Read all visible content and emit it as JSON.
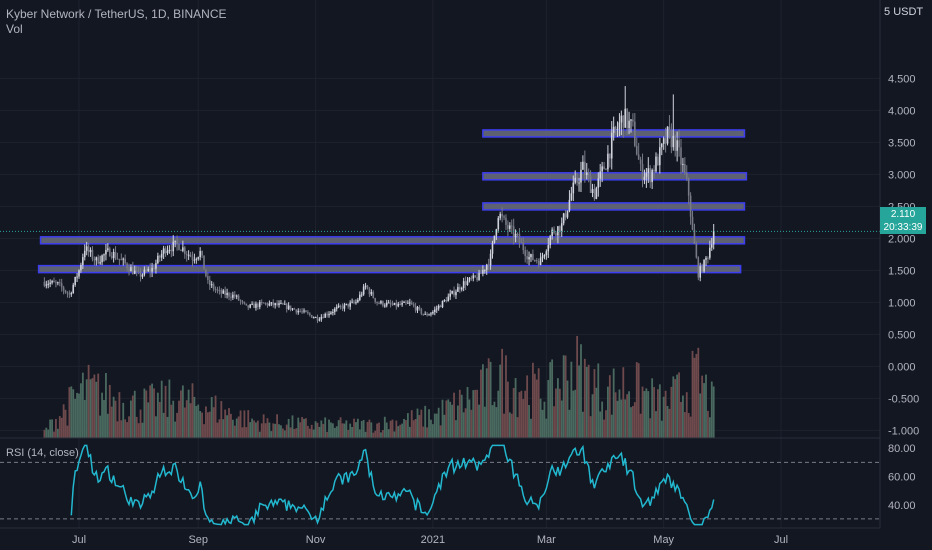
{
  "header": {
    "title": "Kyber Network / TetherUS, 1D, BINANCE",
    "volume_label": "Vol",
    "currency": "USDT"
  },
  "price_badge": {
    "price": "2.110",
    "countdown": "20:33:39",
    "color": "#26a69a"
  },
  "rsi": {
    "label": "RSI (14, close)",
    "ticks": [
      "80.00",
      "60.00",
      "40.00"
    ],
    "bands": [
      70,
      30
    ],
    "ylim": [
      25,
      83
    ],
    "color": "#22b8cf"
  },
  "colors": {
    "background": "#131722",
    "up": "#d1d4dc",
    "down": "#787b86",
    "zone_fill": "#6b6f80",
    "zone_border": "#3d3ef0",
    "grid": "#1e222d"
  },
  "chart_data": {
    "type": "candlestick",
    "title": "Kyber Network / TetherUS, 1D, BINANCE",
    "y_axis_ticks": [
      "4.500",
      "4.000",
      "3.500",
      "3.000",
      "2.500",
      "2.000",
      "1.500",
      "1.000",
      "0.500",
      "0.000",
      "-0.500",
      "-1.000"
    ],
    "ylim": [
      -1.15,
      5.1
    ],
    "x_axis_ticks": [
      "Jul",
      "Sep",
      "Nov",
      "2021",
      "Mar",
      "May",
      "Jul"
    ],
    "x_tick_dates": [
      "2020-07-01",
      "2020-09-01",
      "2020-11-01",
      "2021-01-01",
      "2021-03-01",
      "2021-05-01",
      "2021-07-01"
    ],
    "date_range": [
      "2020-06-13",
      "2021-05-22"
    ],
    "last_price": 2.11,
    "horizontal_zones": [
      {
        "price": 1.52,
        "start": "2020-06-10",
        "end": "2021-06-10"
      },
      {
        "price": 1.97,
        "start": "2020-06-11",
        "end": "2021-06-12"
      },
      {
        "price": 2.5,
        "start": "2021-01-27",
        "end": "2021-06-12"
      },
      {
        "price": 2.97,
        "start": "2021-01-27",
        "end": "2021-06-13"
      },
      {
        "price": 3.64,
        "start": "2021-01-27",
        "end": "2021-06-12"
      }
    ],
    "price_path": [
      [
        "2020-06-13",
        1.32
      ],
      [
        "2020-06-20",
        1.28
      ],
      [
        "2020-06-26",
        1.12
      ],
      [
        "2020-07-01",
        1.5
      ],
      [
        "2020-07-04",
        1.85
      ],
      [
        "2020-07-10",
        1.65
      ],
      [
        "2020-07-17",
        1.8
      ],
      [
        "2020-07-25",
        1.6
      ],
      [
        "2020-08-01",
        1.42
      ],
      [
        "2020-08-08",
        1.52
      ],
      [
        "2020-08-15",
        1.85
      ],
      [
        "2020-08-22",
        1.9
      ],
      [
        "2020-08-29",
        1.7
      ],
      [
        "2020-09-02",
        1.78
      ],
      [
        "2020-09-06",
        1.3
      ],
      [
        "2020-09-12",
        1.15
      ],
      [
        "2020-09-20",
        1.1
      ],
      [
        "2020-09-26",
        0.92
      ],
      [
        "2020-10-05",
        0.98
      ],
      [
        "2020-10-15",
        0.95
      ],
      [
        "2020-10-25",
        0.85
      ],
      [
        "2020-11-02",
        0.75
      ],
      [
        "2020-11-12",
        0.9
      ],
      [
        "2020-11-22",
        1.0
      ],
      [
        "2020-11-27",
        1.25
      ],
      [
        "2020-12-03",
        1.0
      ],
      [
        "2020-12-12",
        0.95
      ],
      [
        "2020-12-20",
        0.98
      ],
      [
        "2020-12-28",
        0.8
      ],
      [
        "2021-01-01",
        0.85
      ],
      [
        "2021-01-08",
        1.05
      ],
      [
        "2021-01-17",
        1.3
      ],
      [
        "2021-01-25",
        1.4
      ],
      [
        "2021-01-31",
        1.7
      ],
      [
        "2021-02-04",
        2.4
      ],
      [
        "2021-02-08",
        2.2
      ],
      [
        "2021-02-14",
        2.0
      ],
      [
        "2021-02-20",
        1.7
      ],
      [
        "2021-02-26",
        1.65
      ],
      [
        "2021-03-04",
        2.1
      ],
      [
        "2021-03-09",
        2.2
      ],
      [
        "2021-03-14",
        2.7
      ],
      [
        "2021-03-20",
        3.1
      ],
      [
        "2021-03-26",
        2.7
      ],
      [
        "2021-04-01",
        3.2
      ],
      [
        "2021-04-05",
        3.6
      ],
      [
        "2021-04-10",
        3.9
      ],
      [
        "2021-04-15",
        3.7
      ],
      [
        "2021-04-19",
        3.05
      ],
      [
        "2021-04-24",
        3.0
      ],
      [
        "2021-04-29",
        3.3
      ],
      [
        "2021-05-03",
        3.6
      ],
      [
        "2021-05-07",
        3.5
      ],
      [
        "2021-05-11",
        3.1
      ],
      [
        "2021-05-14",
        2.7
      ],
      [
        "2021-05-16",
        2.1
      ],
      [
        "2021-05-19",
        1.45
      ],
      [
        "2021-05-22",
        1.6
      ],
      [
        "2021-05-24",
        1.75
      ],
      [
        "2021-05-27",
        2.11
      ]
    ],
    "volume_profile": [
      [
        "2020-06-13",
        0.06
      ],
      [
        "2020-07-04",
        0.45
      ],
      [
        "2020-08-01",
        0.3
      ],
      [
        "2020-08-20",
        0.35
      ],
      [
        "2020-09-04",
        0.3
      ],
      [
        "2020-10-01",
        0.15
      ],
      [
        "2020-11-01",
        0.12
      ],
      [
        "2020-12-01",
        0.12
      ],
      [
        "2021-01-01",
        0.2
      ],
      [
        "2021-01-20",
        0.35
      ],
      [
        "2021-02-05",
        0.55
      ],
      [
        "2021-03-01",
        0.4
      ],
      [
        "2021-03-15",
        0.65
      ],
      [
        "2021-04-01",
        0.4
      ],
      [
        "2021-04-12",
        0.5
      ],
      [
        "2021-05-01",
        0.3
      ],
      [
        "2021-05-19",
        0.55
      ],
      [
        "2021-05-27",
        0.3
      ]
    ]
  }
}
